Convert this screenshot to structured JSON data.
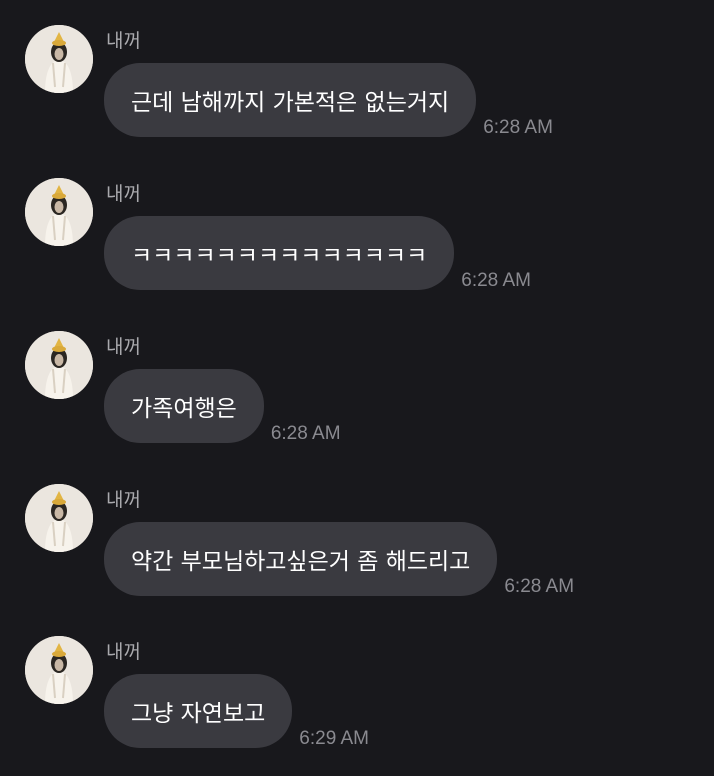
{
  "messages": [
    {
      "sender": "내꺼",
      "text": "근데 남해까지 가본적은 없는거지",
      "time": "6:28 AM"
    },
    {
      "sender": "내꺼",
      "text": "ㅋㅋㅋㅋㅋㅋㅋㅋㅋㅋㅋㅋㅋㅋ",
      "time": "6:28 AM"
    },
    {
      "sender": "내꺼",
      "text": "가족여행은",
      "time": "6:28 AM"
    },
    {
      "sender": "내꺼",
      "text": "약간 부모님하고싶은거 좀 해드리고",
      "time": "6:28 AM"
    },
    {
      "sender": "내꺼",
      "text": "그냥 자연보고",
      "time": "6:29 AM"
    }
  ],
  "icons": {
    "avatar": "profile-photo-avatar"
  },
  "colors": {
    "background": "#18181c",
    "bubble": "#3a3a40",
    "sender_text": "#a9a9ad",
    "time_text": "#8a8a90",
    "message_text": "#ffffff"
  }
}
